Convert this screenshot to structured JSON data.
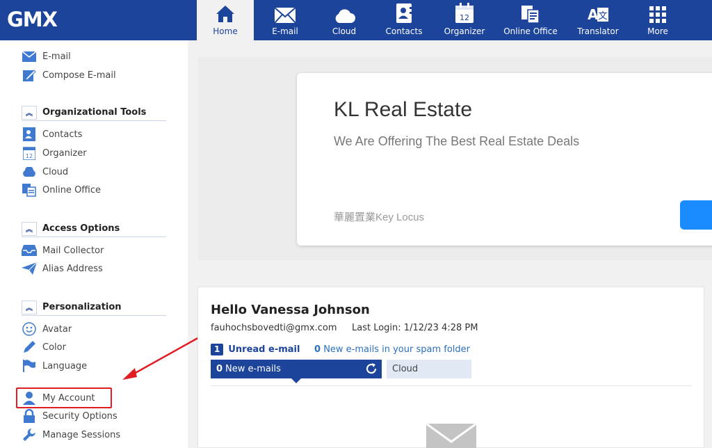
{
  "app": {
    "logo": "GMX"
  },
  "nav": [
    {
      "label": "Home",
      "icon": "home-icon",
      "active": true
    },
    {
      "label": "E-mail",
      "icon": "envelope-icon"
    },
    {
      "label": "Cloud",
      "icon": "cloud-icon"
    },
    {
      "label": "Contacts",
      "icon": "contacts-icon"
    },
    {
      "label": "Organizer",
      "icon": "calendar-icon"
    },
    {
      "label": "Online Office",
      "icon": "office-icon"
    },
    {
      "label": "Translator",
      "icon": "translate-icon"
    },
    {
      "label": "More",
      "icon": "grid-icon"
    }
  ],
  "sidebar": {
    "top_links": [
      {
        "label": "E-mail",
        "icon": "envelope-icon"
      },
      {
        "label": "Compose E-mail",
        "icon": "compose-icon"
      }
    ],
    "sections": [
      {
        "title": "Organizational Tools",
        "items": [
          {
            "label": "Contacts",
            "icon": "contacts-icon"
          },
          {
            "label": "Organizer",
            "icon": "calendar-icon"
          },
          {
            "label": "Cloud",
            "icon": "cloud-icon"
          },
          {
            "label": "Online Office",
            "icon": "office-icon"
          }
        ]
      },
      {
        "title": "Access Options",
        "items": [
          {
            "label": "Mail Collector",
            "icon": "inbox-icon"
          },
          {
            "label": "Alias Address",
            "icon": "paper-plane-icon"
          }
        ]
      },
      {
        "title": "Personalization",
        "items": [
          {
            "label": "Avatar",
            "icon": "smiley-icon"
          },
          {
            "label": "Color",
            "icon": "pencil-icon"
          },
          {
            "label": "Language",
            "icon": "flag-icon"
          }
        ]
      }
    ],
    "account_links": [
      {
        "label": "My Account",
        "icon": "user-icon"
      },
      {
        "label": "Security Options",
        "icon": "lock-icon"
      },
      {
        "label": "Manage Sessions",
        "icon": "wrench-icon"
      }
    ]
  },
  "ad": {
    "title": "KL Real Estate",
    "subtitle": "We Are Offering The Best Real Estate Deals",
    "footer": "華麗置業Key Locus"
  },
  "mail": {
    "greeting": "Hello Vanessa Johnson",
    "email": "fauhochsbovedti@gmx.com",
    "last_login": "Last Login: 1/12/23 4:28 PM",
    "unread_count": "1",
    "unread_label": "Unread e-mail",
    "spam_count": "0",
    "spam_label": "New e-mails in your spam folder",
    "new_count": "0",
    "new_label": "New e-mails",
    "cloud_tab": "Cloud"
  },
  "colors": {
    "brand": "#1c449b",
    "highlight": "#e11d24",
    "ad_button": "#1a8cff"
  }
}
